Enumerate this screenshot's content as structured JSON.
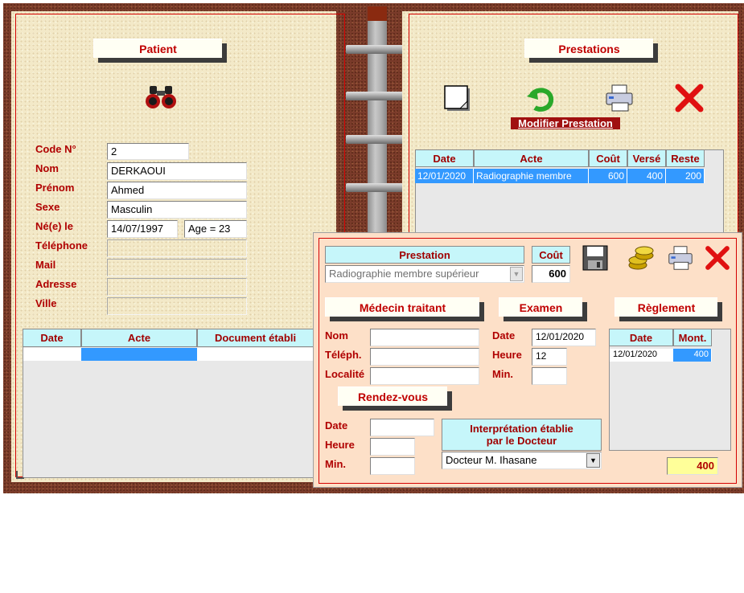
{
  "patient": {
    "title": "Patient",
    "search_icon": "binoculars-icon",
    "fields": {
      "code_label": "Code N°",
      "code_value": "2",
      "nom_label": "Nom",
      "nom_value": "DERKAOUI",
      "prenom_label": "Prénom",
      "prenom_value": "Ahmed",
      "sexe_label": "Sexe",
      "sexe_value": "Masculin",
      "ne_label": "Né(e) le",
      "ne_value": "14/07/1997",
      "age_value": "Age =  23",
      "tel_label": "Téléphone",
      "tel_value": "",
      "mail_label": "Mail",
      "mail_value": "",
      "adresse_label": "Adresse",
      "adresse_value": "",
      "ville_label": "Ville",
      "ville_value": ""
    },
    "table": {
      "headers": [
        "Date",
        "Acte",
        "Document établi"
      ],
      "rows": [
        [
          "",
          "",
          ""
        ]
      ]
    }
  },
  "prestations": {
    "title": "Prestations",
    "icons": [
      "new-document-icon",
      "undo-arrow-icon",
      "printer-icon",
      "close-icon"
    ],
    "modify_label": "Modifier  Prestation",
    "table": {
      "headers": [
        "Date",
        "Acte",
        "Coût",
        "Versé",
        "Reste"
      ],
      "rows": [
        [
          "12/01/2020",
          "Radiographie membre",
          "600",
          "400",
          "200"
        ]
      ]
    }
  },
  "detail": {
    "prestation_header": "Prestation",
    "prestation_value": "Radiographie membre supérieur",
    "cout_header": "Coût",
    "cout_value": "600",
    "icons": [
      "save-disk-icon",
      "coins-icon",
      "printer-icon",
      "close-icon"
    ],
    "medecin_title": "Médecin traitant",
    "examen_title": "Examen",
    "reglement_title": "Règlement",
    "rdv_title": "Rendez-vous",
    "med_nom_label": "Nom",
    "med_tel_label": "Téléph.",
    "med_loc_label": "Localité",
    "med_nom_value": "",
    "med_tel_value": "",
    "med_loc_value": "",
    "exam_date_label": "Date",
    "exam_date_value": "12/01/2020",
    "exam_heure_label": "Heure",
    "exam_heure_value": "12",
    "exam_min_label": "Min.",
    "exam_min_value": "",
    "rdv_date_label": "Date",
    "rdv_heure_label": "Heure",
    "rdv_min_label": "Min.",
    "rdv_date_value": "",
    "rdv_heure_value": "",
    "rdv_min_value": "",
    "interp_header_line1": "Interprétation établie",
    "interp_header_line2": "par le Docteur",
    "interp_value": "Docteur  M. Ihasane",
    "reglement_table": {
      "headers": [
        "Date",
        "Mont."
      ],
      "rows": [
        [
          "12/01/2020",
          "400"
        ]
      ]
    },
    "total_value": "400"
  },
  "colors": {
    "label_red": "#b00000",
    "header_cyan": "#c6f6fa",
    "selection_blue": "#3399ff",
    "detail_bg": "#fde0c8",
    "total_yellow": "#ffff99"
  }
}
